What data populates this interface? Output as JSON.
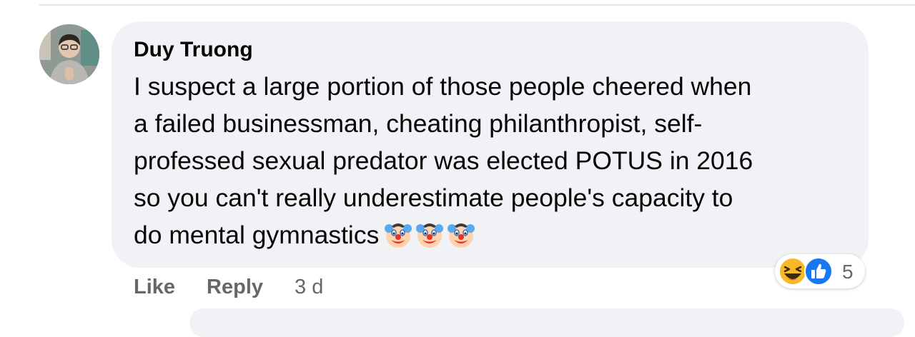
{
  "comment": {
    "author": "Duy Truong",
    "text_lines": [
      "I suspect a large portion of those people cheered when",
      "a failed businessman, cheating philanthropist, self-",
      "professed sexual predator was elected POTUS in 2016",
      "so you can't really underestimate people's capacity to",
      "do mental gymnastics"
    ],
    "trailing_emojis": [
      "clown-face",
      "clown-face",
      "clown-face"
    ],
    "reactions": {
      "icons": [
        "haha",
        "like"
      ],
      "count": "5"
    },
    "actions": {
      "like_label": "Like",
      "reply_label": "Reply",
      "timestamp": "3 d"
    }
  },
  "colors": {
    "bubble": "#f0f2f5",
    "text": "#050505",
    "secondary_text": "#65676b",
    "like_blue": "#1877f2",
    "haha_yellow": "#f7b928"
  }
}
